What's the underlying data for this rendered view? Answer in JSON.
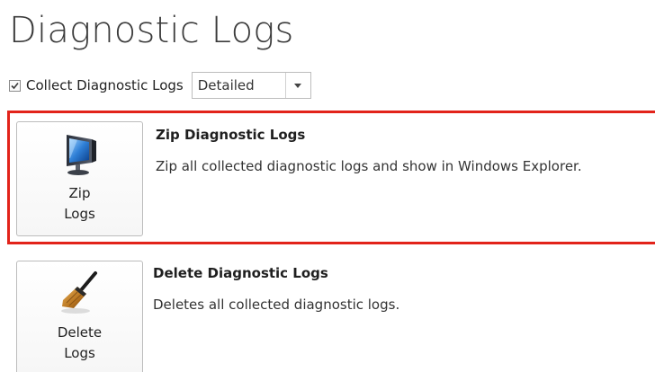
{
  "page": {
    "title": "Diagnostic Logs"
  },
  "collect": {
    "checked": true,
    "label": "Collect Diagnostic Logs",
    "level_selected": "Detailed"
  },
  "zip_action": {
    "button_label": "Zip\nLogs",
    "title": "Zip Diagnostic Logs",
    "description": "Zip all collected diagnostic logs and show in Windows Explorer.",
    "icon": "monitor-zip-icon",
    "highlighted": true,
    "highlight_color": "#e2231a"
  },
  "delete_action": {
    "button_label": "Delete\nLogs",
    "title": "Delete Diagnostic Logs",
    "description": "Deletes all collected diagnostic logs.",
    "icon": "broom-icon"
  }
}
